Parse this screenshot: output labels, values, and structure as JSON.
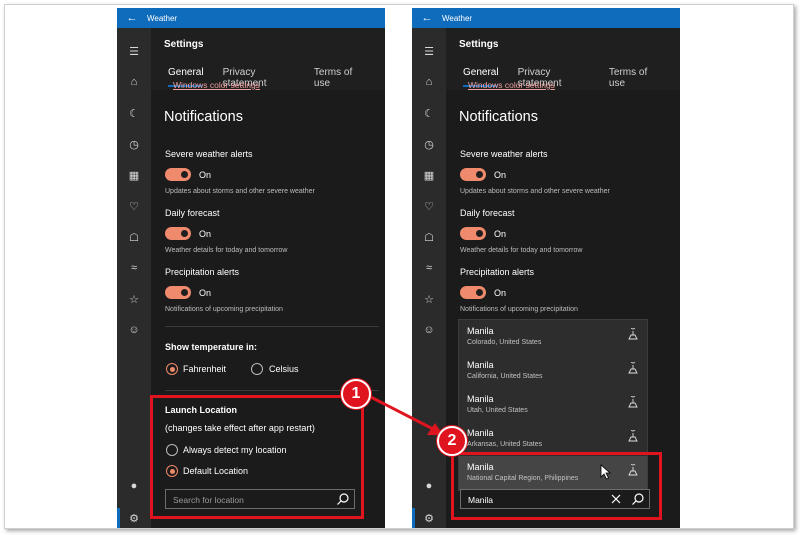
{
  "window": {
    "title": "Weather"
  },
  "settings": {
    "title": "Settings",
    "tabs": [
      "General",
      "Privacy statement",
      "Terms of use"
    ],
    "color_link": "Windows color settings",
    "notifications_heading": "Notifications",
    "alerts": [
      {
        "label": "Severe weather alerts",
        "state": "On",
        "desc": "Updates about storms and other severe weather"
      },
      {
        "label": "Daily forecast",
        "state": "On",
        "desc": "Weather details for today and tomorrow"
      },
      {
        "label": "Precipitation alerts",
        "state": "On",
        "desc": "Notifications of upcoming precipitation"
      }
    ],
    "temperature": {
      "heading": "Show temperature in:",
      "options": [
        "Fahrenheit",
        "Celsius"
      ],
      "selected": "Fahrenheit"
    },
    "launch": {
      "heading": "Launch Location",
      "note": "(changes take effect after app restart)",
      "options": [
        "Always detect my location",
        "Default Location"
      ],
      "selected": "Default Location"
    },
    "search": {
      "placeholder": "Search for location",
      "value": "Manila"
    }
  },
  "suggestions": [
    {
      "name": "Manila",
      "region": "Colorado, United States"
    },
    {
      "name": "Manila",
      "region": "California, United States"
    },
    {
      "name": "Manila",
      "region": "Utah, United States"
    },
    {
      "name": "Manila",
      "region": "Arkansas, United States"
    },
    {
      "name": "Manila",
      "region": "National Capital Region, Philippines"
    }
  ],
  "steps": [
    "1",
    "2"
  ],
  "colors": {
    "accent": "#0f6cbd",
    "toggle": "#f08a6c",
    "highlight": "#e0141e"
  }
}
